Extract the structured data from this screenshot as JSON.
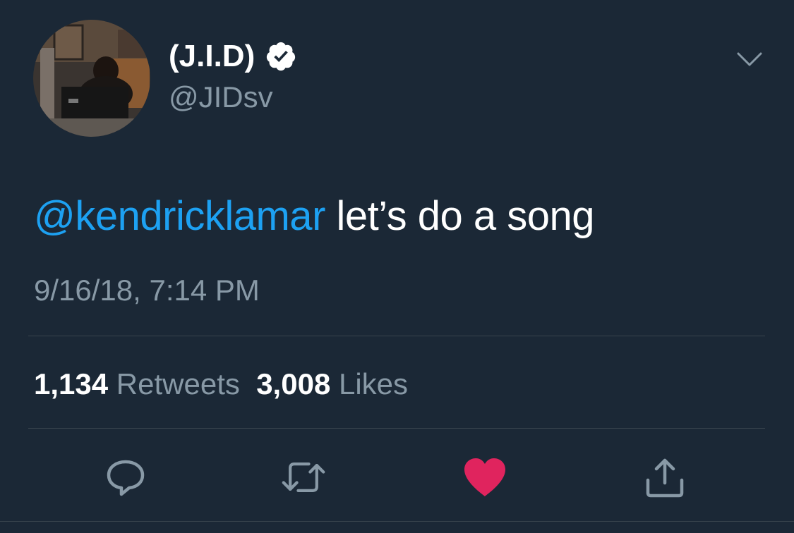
{
  "author": {
    "display_name": "(J.I.D)",
    "handle": "@JIDsv",
    "verified": true
  },
  "tweet": {
    "mention": "@kendricklamar",
    "text": " let’s do a song",
    "timestamp": "9/16/18, 7:14 PM"
  },
  "stats": {
    "retweets_count": "1,134",
    "retweets_label": "Retweets",
    "likes_count": "3,008",
    "likes_label": "Likes"
  },
  "actions": {
    "reply_icon": "reply-icon",
    "retweet_icon": "retweet-icon",
    "like_icon": "heart-icon",
    "share_icon": "share-icon",
    "liked": true
  },
  "colors": {
    "background": "#1b2836",
    "accent": "#1da1f2",
    "muted": "#8899a6",
    "like": "#e0245e",
    "divider": "#38444d"
  }
}
